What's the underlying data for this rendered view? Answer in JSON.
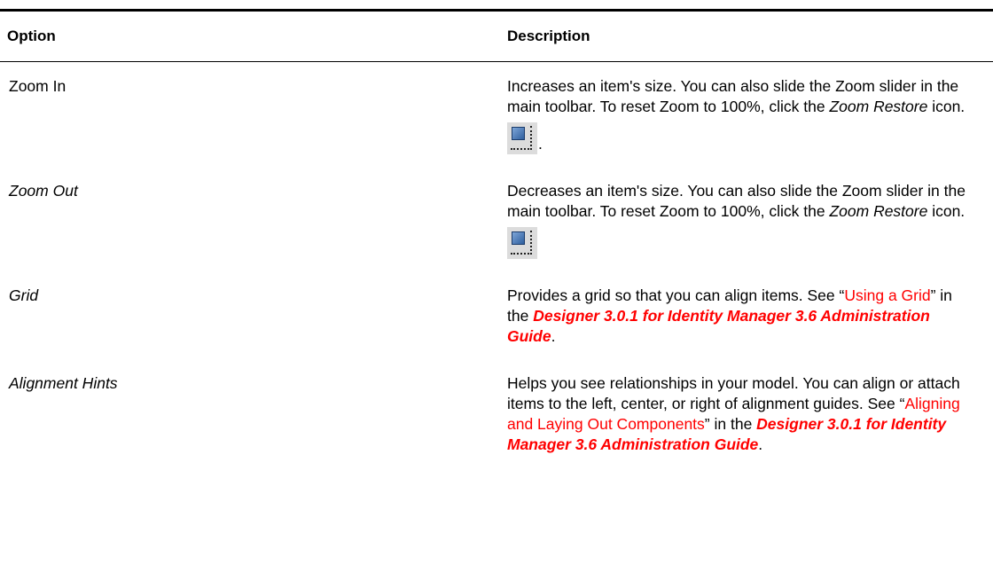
{
  "header": {
    "option_label": "Option",
    "description_label": "Description"
  },
  "rows": [
    {
      "option": "Zoom In",
      "desc_part1": "Increases an item's size. You can also slide the Zoom slider in the main toolbar. To reset Zoom to 100%, click the ",
      "desc_em": "Zoom Restore",
      "desc_part2": " icon.",
      "icon": "zoom-restore-icon",
      "icon_trailing": "."
    },
    {
      "option": "Zoom Out",
      "desc_part1": "Decreases an item's size. You can also slide the Zoom slider in the main toolbar. To reset Zoom to 100%, click the ",
      "desc_em": "Zoom Restore",
      "desc_part2": " icon.",
      "icon": "zoom-restore-icon"
    },
    {
      "option": "Grid",
      "desc_part1": "Provides a grid so that you can align items. See “",
      "link": "Using a Grid",
      "desc_part2": "” in the ",
      "guide": "Designer 3.0.1  for Identity Manager 3.6 Administration Guide",
      "desc_part3": "."
    },
    {
      "option": "Alignment Hints",
      "desc_part1": "Helps you see relationships in your model. You can align or attach items to the left, center, or right of alignment guides. See “",
      "link": "Aligning and Laying Out Components",
      "desc_part2": "” in the ",
      "guide": "Designer 3.0.1  for Identity Manager 3.6 Administration Guide",
      "desc_part3": "."
    }
  ],
  "colors": {
    "link": "#ff0000",
    "icon_bg": "#dcdcdc",
    "icon_blue": "#2f5f9e"
  }
}
